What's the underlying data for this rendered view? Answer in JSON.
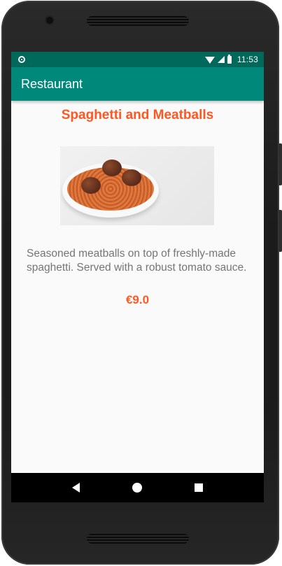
{
  "status_bar": {
    "time": "11:53",
    "icons": [
      "notification-icon",
      "wifi-icon",
      "signal-icon",
      "battery-icon"
    ]
  },
  "app_bar": {
    "title": "Restaurant"
  },
  "dish": {
    "name": "Spaghetti and Meatballs",
    "image_name": "spaghetti-meatballs-photo",
    "description": "Seasoned meatballs on top of freshly-made spaghetti. Served with a robust tomato sauce.",
    "price": "€9.0"
  },
  "nav_bar": {
    "icons": [
      "back-icon",
      "home-icon",
      "recents-icon"
    ]
  },
  "colors": {
    "primary": "#00897b",
    "primary_dark": "#00695c",
    "accent": "#ff5722",
    "body_text": "#757575",
    "background": "#fafafa"
  }
}
